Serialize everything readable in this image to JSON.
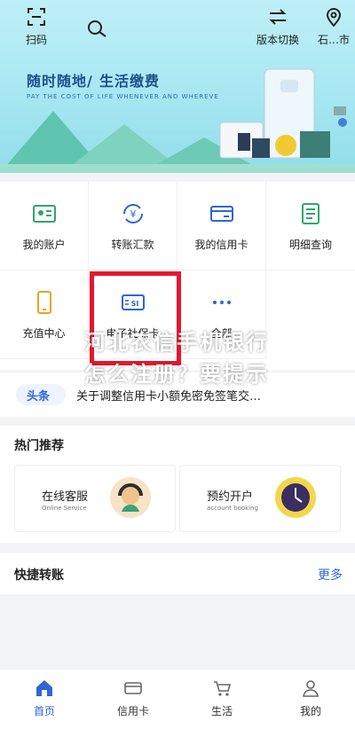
{
  "header": {
    "scan_label": "扫码",
    "switch_label": "版本切换",
    "location_label": "石…市"
  },
  "banner": {
    "title_left": "随时随地",
    "title_right": "生活缴费",
    "subtitle": "PAY THE COST OF LIFE WHENEVER AND WHEREVE"
  },
  "menu": {
    "items": [
      {
        "label": "我的账户",
        "icon": "account-card-icon"
      },
      {
        "label": "转账汇款",
        "icon": "transfer-yen-icon"
      },
      {
        "label": "我的信用卡",
        "icon": "credit-card-icon"
      },
      {
        "label": "明细查询",
        "icon": "document-list-icon"
      },
      {
        "label": "充值中心",
        "icon": "phone-recharge-icon"
      },
      {
        "label": "电子社保卡",
        "icon": "social-security-card-icon"
      },
      {
        "label": "全部",
        "icon": "more-dots-icon"
      }
    ]
  },
  "news": {
    "tag": "头条",
    "text": "关于调整信用卡小额免密免签笔交…"
  },
  "overlay_text": {
    "line1": "河北农信手机银行",
    "line2": "怎么注册？要提示"
  },
  "hot": {
    "title": "热门推荐",
    "cards": [
      {
        "title": "在线客服",
        "subtitle": "Online Service",
        "icon": "customer-service-icon"
      },
      {
        "title": "预约开户",
        "subtitle": "account booking",
        "icon": "clock-booking-icon"
      }
    ]
  },
  "quick": {
    "title": "快捷转账",
    "more": "更多"
  },
  "tabbar": {
    "items": [
      {
        "label": "首页",
        "icon": "home-icon",
        "active": true
      },
      {
        "label": "信用卡",
        "icon": "credit-card-tab-icon"
      },
      {
        "label": "生活",
        "icon": "cart-icon"
      },
      {
        "label": "我的",
        "icon": "profile-icon"
      }
    ]
  },
  "colors": {
    "accent": "#2f66d4",
    "highlight": "#e5172f",
    "banner_title": "#1f4f8f"
  }
}
